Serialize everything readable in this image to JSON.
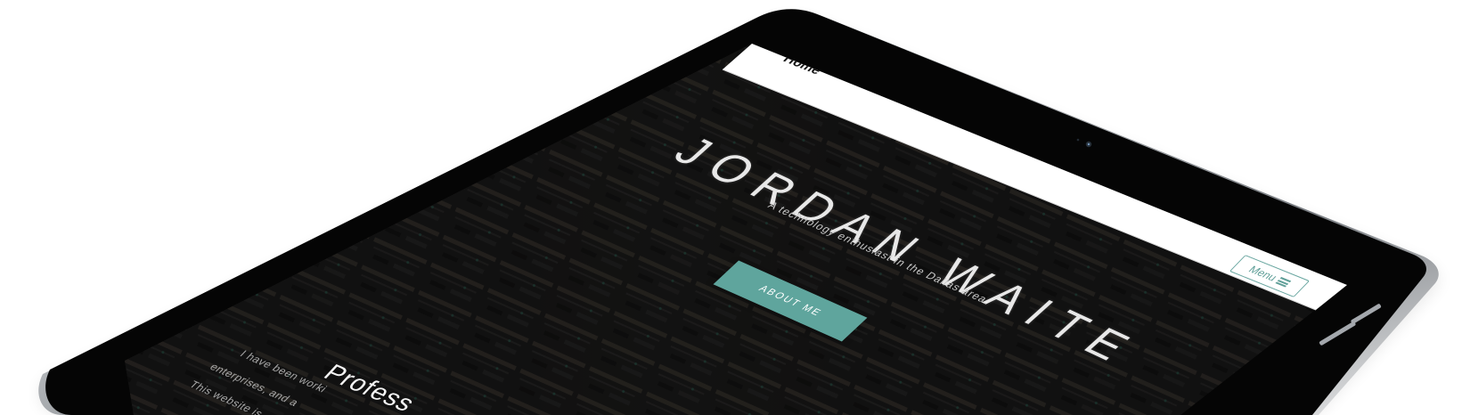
{
  "site": {
    "nav": {
      "home_label": "Home",
      "menu_label": "Menu",
      "menu_icon": "hamburger-menu-icon"
    },
    "hero": {
      "title": "JORDAN WAITE",
      "subtitle": "A technology enthusiast in the Dallas area.",
      "button_label": "ABOUT ME"
    },
    "section": {
      "heading_visible": "Profess",
      "text_lines": [
        "I have been worki",
        "enterprises, and a",
        "This website is"
      ]
    }
  },
  "colors": {
    "accent": "#5fa59d",
    "device_frame": "#050505",
    "device_edge": "#bfc3c7",
    "header_bg": "#ffffff",
    "hero_bg": "#1a1918"
  }
}
